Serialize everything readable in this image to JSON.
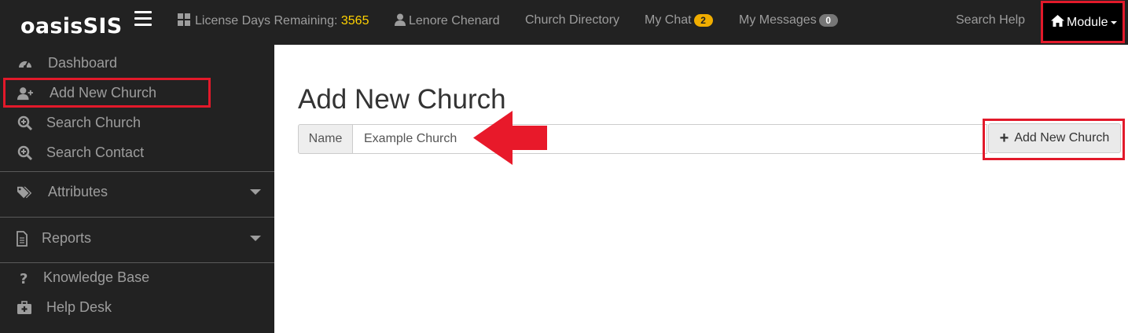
{
  "brand": "oasisSIS",
  "topnav": {
    "license_label": "License Days Remaining:",
    "license_days": "3565",
    "user_name": "Lenore Chenard",
    "church_directory": "Church Directory",
    "my_chat": "My Chat",
    "my_chat_count": "2",
    "my_messages": "My Messages",
    "my_messages_count": "0",
    "search_help": "Search Help",
    "module": "Module"
  },
  "sidebar": {
    "items": [
      {
        "label": "Dashboard",
        "icon": "tachometer-icon"
      },
      {
        "label": "Add New Church",
        "icon": "user-plus-icon"
      },
      {
        "label": "Search Church",
        "icon": "search-plus-icon"
      },
      {
        "label": "Search Contact",
        "icon": "search-plus-icon"
      },
      {
        "label": "Attributes",
        "icon": "tags-icon"
      },
      {
        "label": "Reports",
        "icon": "file-icon"
      },
      {
        "label": "Knowledge Base",
        "icon": "question-icon"
      },
      {
        "label": "Help Desk",
        "icon": "medkit-icon"
      }
    ]
  },
  "main": {
    "title": "Add New Church",
    "name_addon": "Name",
    "name_value": "Example Church",
    "add_button": "Add New Church"
  },
  "colors": {
    "navbar": "#222222",
    "annotation_red": "#e2192a",
    "license_highlight": "#ffd200"
  }
}
